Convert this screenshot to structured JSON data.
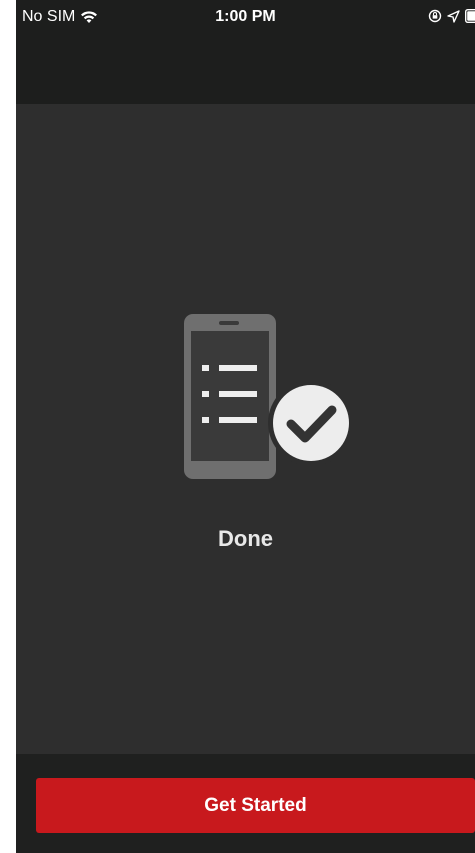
{
  "status_bar": {
    "carrier": "No SIM",
    "time": "1:00 PM",
    "icons": [
      "wifi-icon",
      "orientation-lock-icon",
      "location-arrow-icon",
      "battery-icon"
    ]
  },
  "main": {
    "illustration": "phone-checklist-with-checkmark-icon",
    "status_text": "Done"
  },
  "footer": {
    "button_label": "Get Started"
  },
  "colors": {
    "accent": "#c8191d",
    "background": "#2e2e2e",
    "bars": "#1d1e1d"
  }
}
